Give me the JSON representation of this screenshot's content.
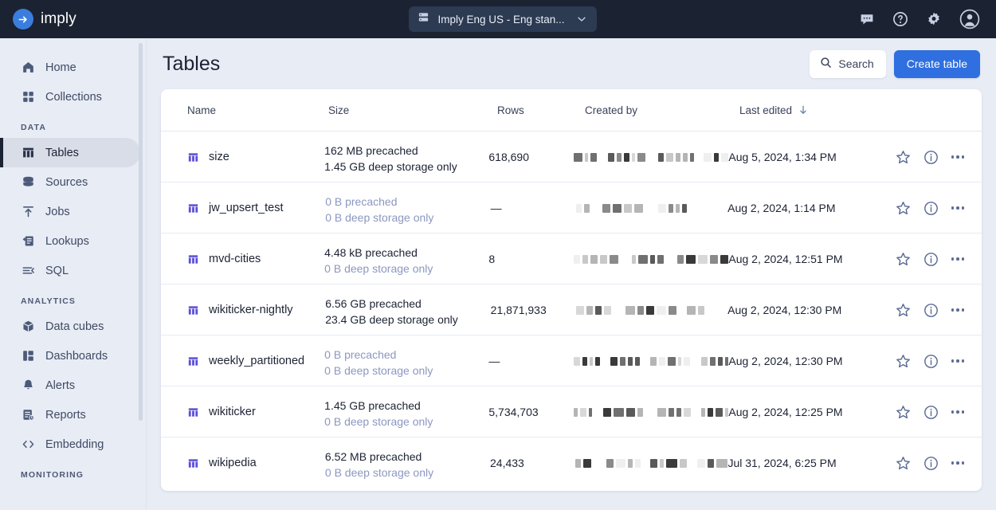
{
  "colors": {
    "topbar_bg": "#1b2231",
    "accent_blue": "#2f6fe0",
    "page_bg": "#e8ecf5",
    "table_icon": "#5b4fd6",
    "muted_text": "#8c97c0",
    "sidebar_active_bg": "#d8dde8"
  },
  "topbar": {
    "brand_name": "imply",
    "brand_icon": "arrow-right-circle-icon",
    "cluster": {
      "label": "Imply Eng US - Eng stan...",
      "icon": "server-icon",
      "caret_icon": "chevron-down-icon"
    },
    "icons": [
      {
        "name": "chat-icon",
        "label": "Chat"
      },
      {
        "name": "help-icon",
        "label": "Help"
      },
      {
        "name": "gear-icon",
        "label": "Settings"
      },
      {
        "name": "account-icon",
        "label": "Account"
      }
    ]
  },
  "sidebar": {
    "top_items": [
      {
        "label": "Home",
        "icon": "home-icon",
        "active": false
      },
      {
        "label": "Collections",
        "icon": "grid-icon",
        "active": false
      }
    ],
    "sections": [
      {
        "title": "DATA",
        "items": [
          {
            "label": "Tables",
            "icon": "table-icon",
            "active": true
          },
          {
            "label": "Sources",
            "icon": "database-icon",
            "active": false
          },
          {
            "label": "Jobs",
            "icon": "upload-icon",
            "active": false
          },
          {
            "label": "Lookups",
            "icon": "lookup-icon",
            "active": false
          },
          {
            "label": "SQL",
            "icon": "sql-icon",
            "active": false
          }
        ]
      },
      {
        "title": "ANALYTICS",
        "items": [
          {
            "label": "Data cubes",
            "icon": "cube-icon",
            "active": false
          },
          {
            "label": "Dashboards",
            "icon": "dashboard-icon",
            "active": false
          },
          {
            "label": "Alerts",
            "icon": "bell-icon",
            "active": false
          },
          {
            "label": "Reports",
            "icon": "report-icon",
            "active": false
          },
          {
            "label": "Embedding",
            "icon": "code-icon",
            "active": false
          }
        ]
      },
      {
        "title": "MONITORING",
        "items": []
      }
    ]
  },
  "page": {
    "title": "Tables",
    "search_label": "Search",
    "search_icon": "search-icon",
    "create_label": "Create table"
  },
  "table": {
    "columns": [
      {
        "key": "name",
        "label": "Name"
      },
      {
        "key": "size",
        "label": "Size"
      },
      {
        "key": "rows",
        "label": "Rows"
      },
      {
        "key": "by",
        "label": "Created by"
      },
      {
        "key": "edit",
        "label": "Last edited",
        "sort_icon": "arrow-down-icon",
        "sorted": "desc"
      },
      {
        "key": "act",
        "label": ""
      }
    ],
    "row_actions": [
      {
        "name": "favorite-star-icon"
      },
      {
        "name": "info-icon"
      },
      {
        "name": "more-options-icon"
      }
    ],
    "rows": [
      {
        "name": "size",
        "icon": "table-icon",
        "size_precached": "162 MB precached",
        "size_precached_muted": false,
        "size_deep": "1.45 GB deep storage only",
        "size_deep_muted": false,
        "rows": "618,690",
        "created_by": "redacted",
        "last_edited": "Aug 5, 2024, 1:34 PM"
      },
      {
        "name": "jw_upsert_test",
        "icon": "table-icon",
        "size_precached": "0 B precached",
        "size_precached_muted": true,
        "size_deep": "0 B deep storage only",
        "size_deep_muted": true,
        "rows": "—",
        "created_by": "redacted",
        "last_edited": "Aug 2, 2024, 1:14 PM"
      },
      {
        "name": "mvd-cities",
        "icon": "table-icon",
        "size_precached": "4.48 kB precached",
        "size_precached_muted": false,
        "size_deep": "0 B deep storage only",
        "size_deep_muted": true,
        "rows": "8",
        "created_by": "redacted",
        "last_edited": "Aug 2, 2024, 12:51 PM"
      },
      {
        "name": "wikiticker-nightly",
        "icon": "table-icon",
        "size_precached": "6.56 GB precached",
        "size_precached_muted": false,
        "size_deep": "23.4 GB deep storage only",
        "size_deep_muted": false,
        "rows": "21,871,933",
        "created_by": "redacted",
        "last_edited": "Aug 2, 2024, 12:30 PM"
      },
      {
        "name": "weekly_partitioned",
        "icon": "table-icon",
        "size_precached": "0 B precached",
        "size_precached_muted": true,
        "size_deep": "0 B deep storage only",
        "size_deep_muted": true,
        "rows": "—",
        "created_by": "redacted",
        "last_edited": "Aug 2, 2024, 12:30 PM"
      },
      {
        "name": "wikiticker",
        "icon": "table-icon",
        "size_precached": "1.45 GB precached",
        "size_precached_muted": false,
        "size_deep": "0 B deep storage only",
        "size_deep_muted": true,
        "rows": "5,734,703",
        "created_by": "redacted",
        "last_edited": "Aug 2, 2024, 12:25 PM"
      },
      {
        "name": "wikipedia",
        "icon": "table-icon",
        "size_precached": "6.52 MB precached",
        "size_precached_muted": false,
        "size_deep": "0 B deep storage only",
        "size_deep_muted": true,
        "rows": "24,433",
        "created_by": "redacted",
        "last_edited": "Jul 31, 2024, 6:25 PM"
      }
    ]
  }
}
